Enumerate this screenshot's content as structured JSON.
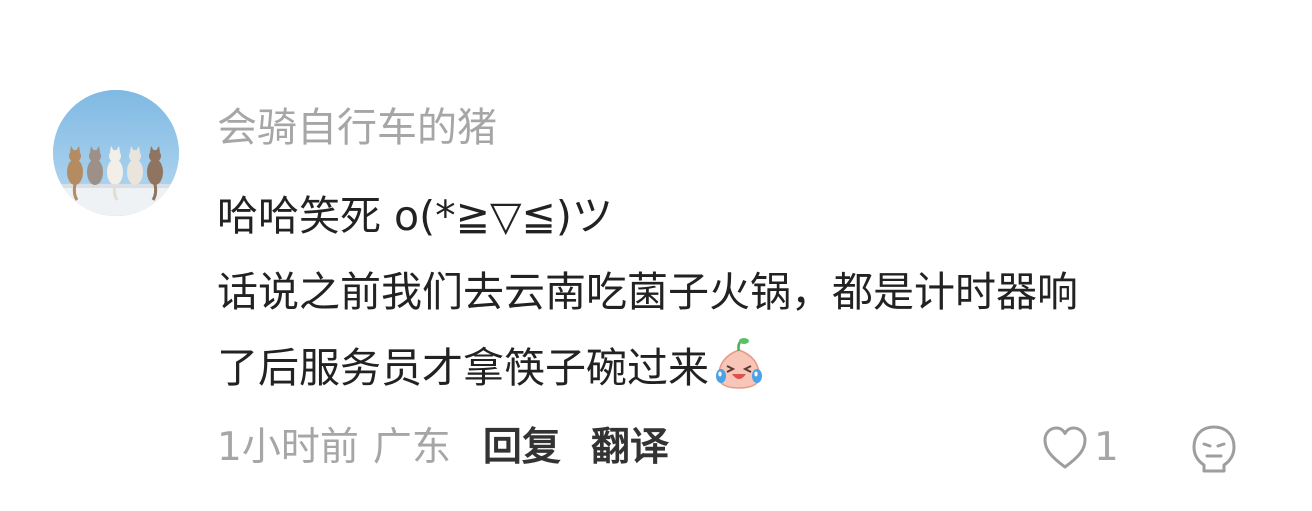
{
  "comment": {
    "avatar_icon": "avatar-cats-on-fence",
    "username": "会骑自行车的猪",
    "content_lines": [
      "哈哈笑死 o(*≧▽≦)ツ",
      "话说之前我们去云南吃菌子火锅，都是计时器响",
      "了后服务员才拿筷子碗过来"
    ],
    "sticker_icon": "laughing-tears-sticker",
    "time": "1小时前",
    "location": "广东",
    "reply_label": "回复",
    "translate_label": "翻译",
    "like_icon": "heart-outline-icon",
    "like_count": "1",
    "dislike_icon": "meh-face-icon"
  },
  "colors": {
    "username": "#a6a6a6",
    "content": "#222222",
    "meta": "#a6a6a6",
    "action": "#333333",
    "icon": "#b5b5b5"
  }
}
